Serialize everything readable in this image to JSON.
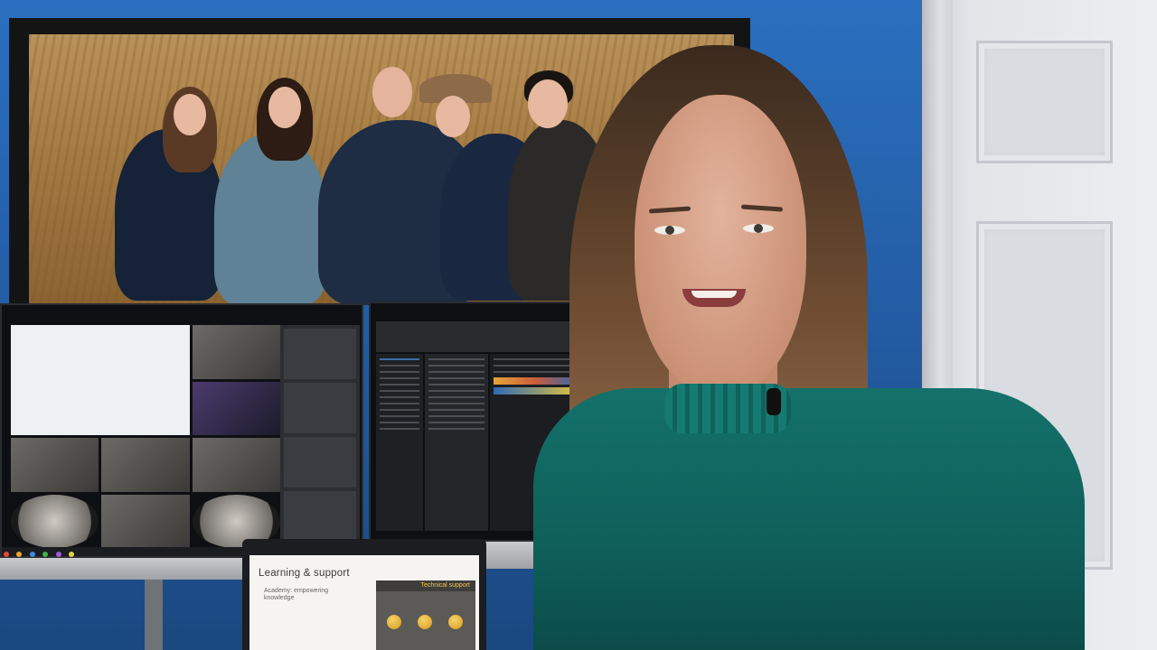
{
  "scene": {
    "description_tag": "video-frame-office-speaker",
    "colors": {
      "wall": "#225aa0",
      "shirt": "#14716a",
      "door": "#e2e4e8"
    }
  },
  "laptop": {
    "title": "Learning & support",
    "subtitle": "Academy: empowering knowledge",
    "technical_support_label": "Technical support"
  }
}
